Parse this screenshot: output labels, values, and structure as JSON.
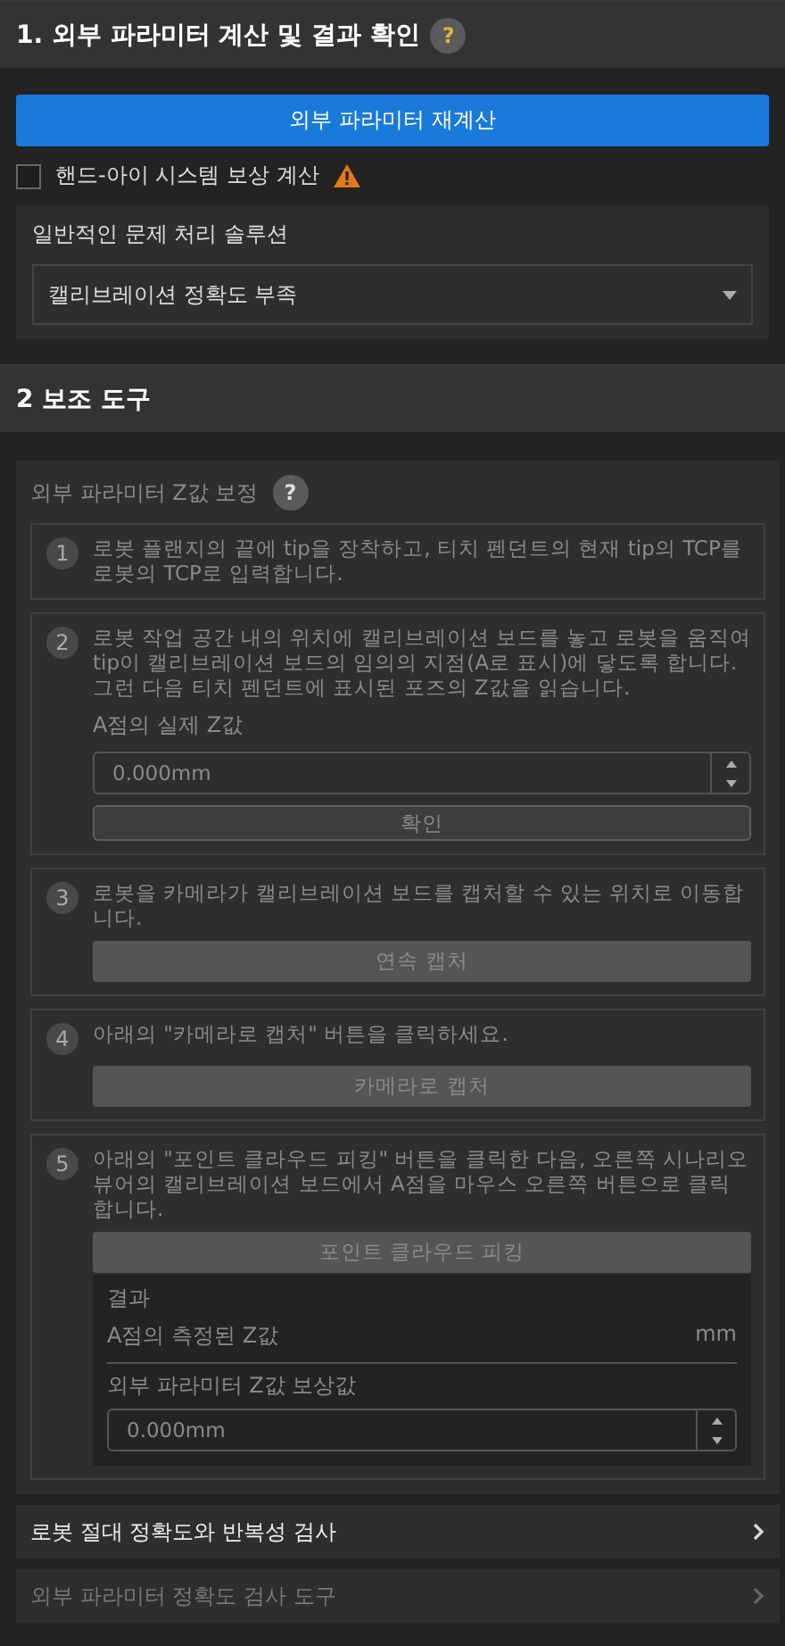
{
  "section1": {
    "number": "1.",
    "title": "외부 파라미터 계산 및 결과 확인",
    "help": "?",
    "recalc_button": "외부 파라미터 재계산",
    "compensation": {
      "label": "핸드-아이 시스템 보상 계산",
      "checked": false,
      "warning": true
    },
    "troubleshooting": {
      "label": "일반적인 문제 처리 솔루션",
      "value": "캘리브레이션 정확도 부족"
    }
  },
  "section2": {
    "number": "2",
    "title": "보조 도구",
    "z_correction": {
      "title": "외부 파라미터 Z값 보정",
      "help": "?",
      "disabled": true,
      "steps": [
        {
          "kind": "text",
          "number": "1",
          "text": "로봇 플랜지의 끝에 tip을 장착하고, 티치 펜던트의 현재 tip의 TCP를 로봇의 TCP로 입력합니다."
        },
        {
          "kind": "input",
          "number": "2",
          "text": "로봇 작업 공간 내의 위치에 캘리브레이션 보드를 놓고 로봇을 움직여 tip이 캘리브레이션 보드의 임의의 지점(A로 표시)에 닿도록 합니다. 그런 다음 티치 펜던트에 표시된 포즈의 Z값을 읽습니다.",
          "field_label": "A점의 실제 Z값",
          "value": "0.000mm",
          "button": "확인"
        },
        {
          "kind": "button",
          "number": "3",
          "text": "로봇을 카메라가 캘리브레이션 보드를 캡처할 수 있는 위치로 이동합니다.",
          "button": "연속 캡처"
        },
        {
          "kind": "button",
          "number": "4",
          "text": "아래의 \"카메라로 캡처\" 버튼을 클릭하세요.",
          "button": "카메라로 캡처"
        },
        {
          "kind": "picking",
          "number": "5",
          "text": "아래의 \"포인트 클라우드 피킹\" 버튼을 클릭한 다음, 오른쪽 시나리오 뷰어의 캘리브레이션 보드에서 A점을 마우스 오른쪽 버튼으로 클릭합니다.",
          "button": "포인트 클라우드 피킹",
          "result": {
            "title": "결과",
            "measured_label": "A점의 측정된 Z값",
            "measured_unit": "mm",
            "offset_label": "외부 파라미터 Z값 보상값",
            "offset_value": "0.000mm"
          }
        }
      ]
    },
    "collapsibles": [
      {
        "label": "로봇 절대 정확도와 반복성 검사",
        "disabled": false
      },
      {
        "label": "외부 파라미터 정확도 검사 도구",
        "disabled": true
      }
    ]
  }
}
